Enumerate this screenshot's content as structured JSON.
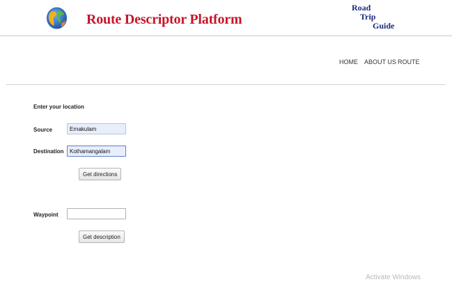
{
  "header": {
    "title": "Route Descriptor Platform",
    "logo_line1": "Road",
    "logo_line2": "Trip",
    "logo_line3": "Guide"
  },
  "nav": {
    "items": [
      {
        "label": "HOME"
      },
      {
        "label": "ABOUT US"
      },
      {
        "label": "ROUTE"
      }
    ]
  },
  "form": {
    "heading": "Enter your location",
    "source_label": "Source",
    "source_value": "Ernakulam",
    "destination_label": "Destination",
    "destination_value": "Kothamangalam",
    "directions_button": "Get directions",
    "waypoint_label": "Waypoint",
    "waypoint_value": "",
    "description_button": "Get description"
  },
  "overlay": {
    "watermark": "Activate Windows"
  },
  "colors": {
    "title": "#c8142a",
    "logo": "#1b2b7a",
    "field_fill": "#e8eefb"
  },
  "icons": {
    "logo": "globe-icon"
  }
}
